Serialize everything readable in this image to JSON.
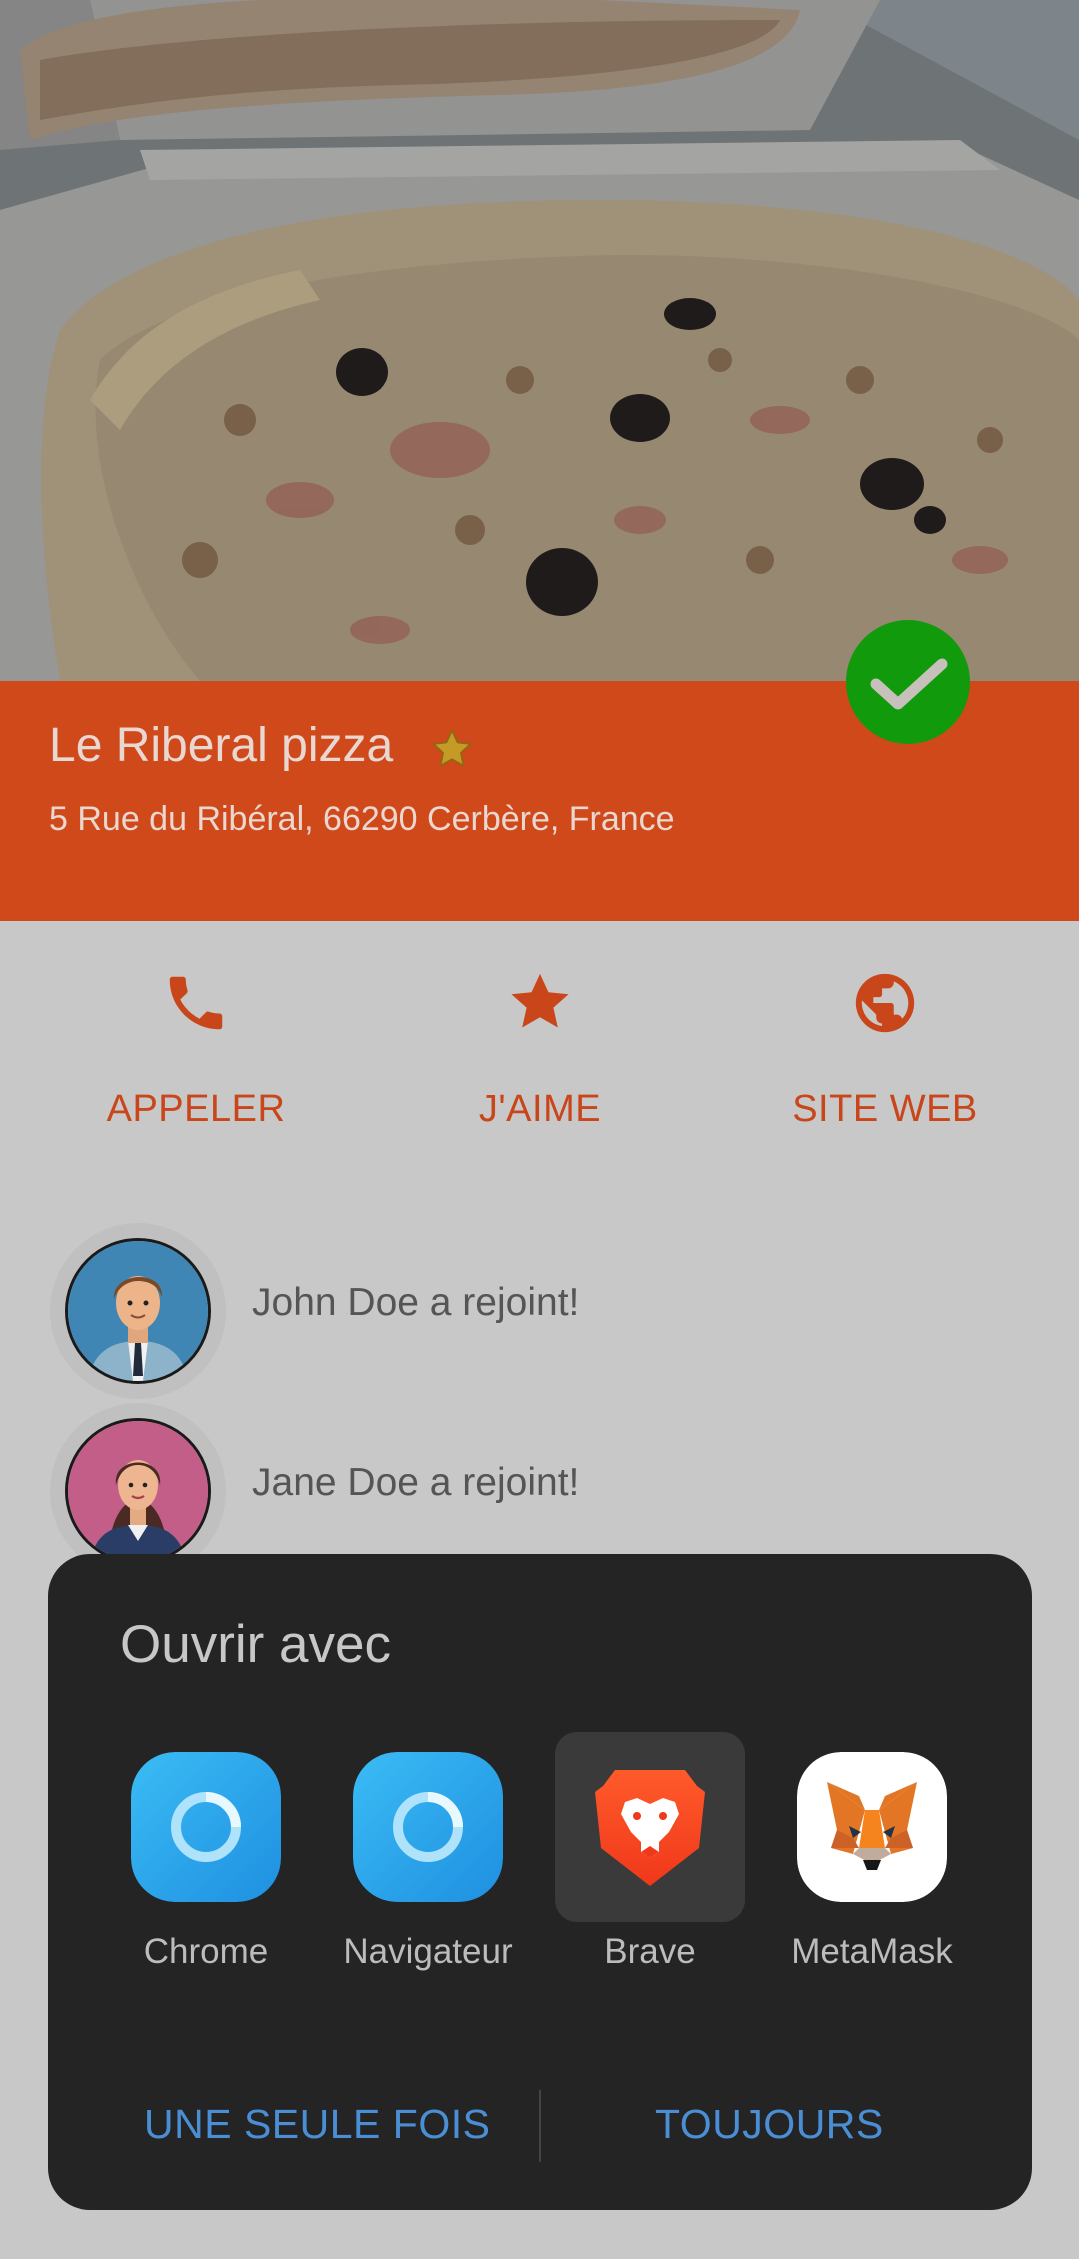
{
  "place": {
    "name": "Le Riberal pizza",
    "address": "5 Rue du Ribéral, 66290 Cerbère, France"
  },
  "actions": [
    {
      "label": "APPELER",
      "icon": "phone-icon"
    },
    {
      "label": "J'AIME",
      "icon": "star-icon"
    },
    {
      "label": "SITE WEB",
      "icon": "globe-icon"
    }
  ],
  "members": [
    {
      "text": "John Doe a rejoint!"
    },
    {
      "text": "Jane Doe a rejoint!"
    }
  ],
  "open_with": {
    "title": "Ouvrir avec",
    "apps": [
      {
        "name": "Chrome",
        "icon": "browser-ring-icon"
      },
      {
        "name": "Navigateur",
        "icon": "browser-ring-icon"
      },
      {
        "name": "Brave",
        "icon": "brave-lion-icon"
      },
      {
        "name": "MetaMask",
        "icon": "metamask-fox-icon"
      }
    ],
    "once_label": "UNE SEULE FOIS",
    "always_label": "TOUJOURS"
  },
  "colors": {
    "banner": "#cf491b",
    "accent": "#c9461b",
    "check": "#119a0b",
    "sheet_bg": "#242424",
    "sheet_button": "#4a8fd6"
  }
}
